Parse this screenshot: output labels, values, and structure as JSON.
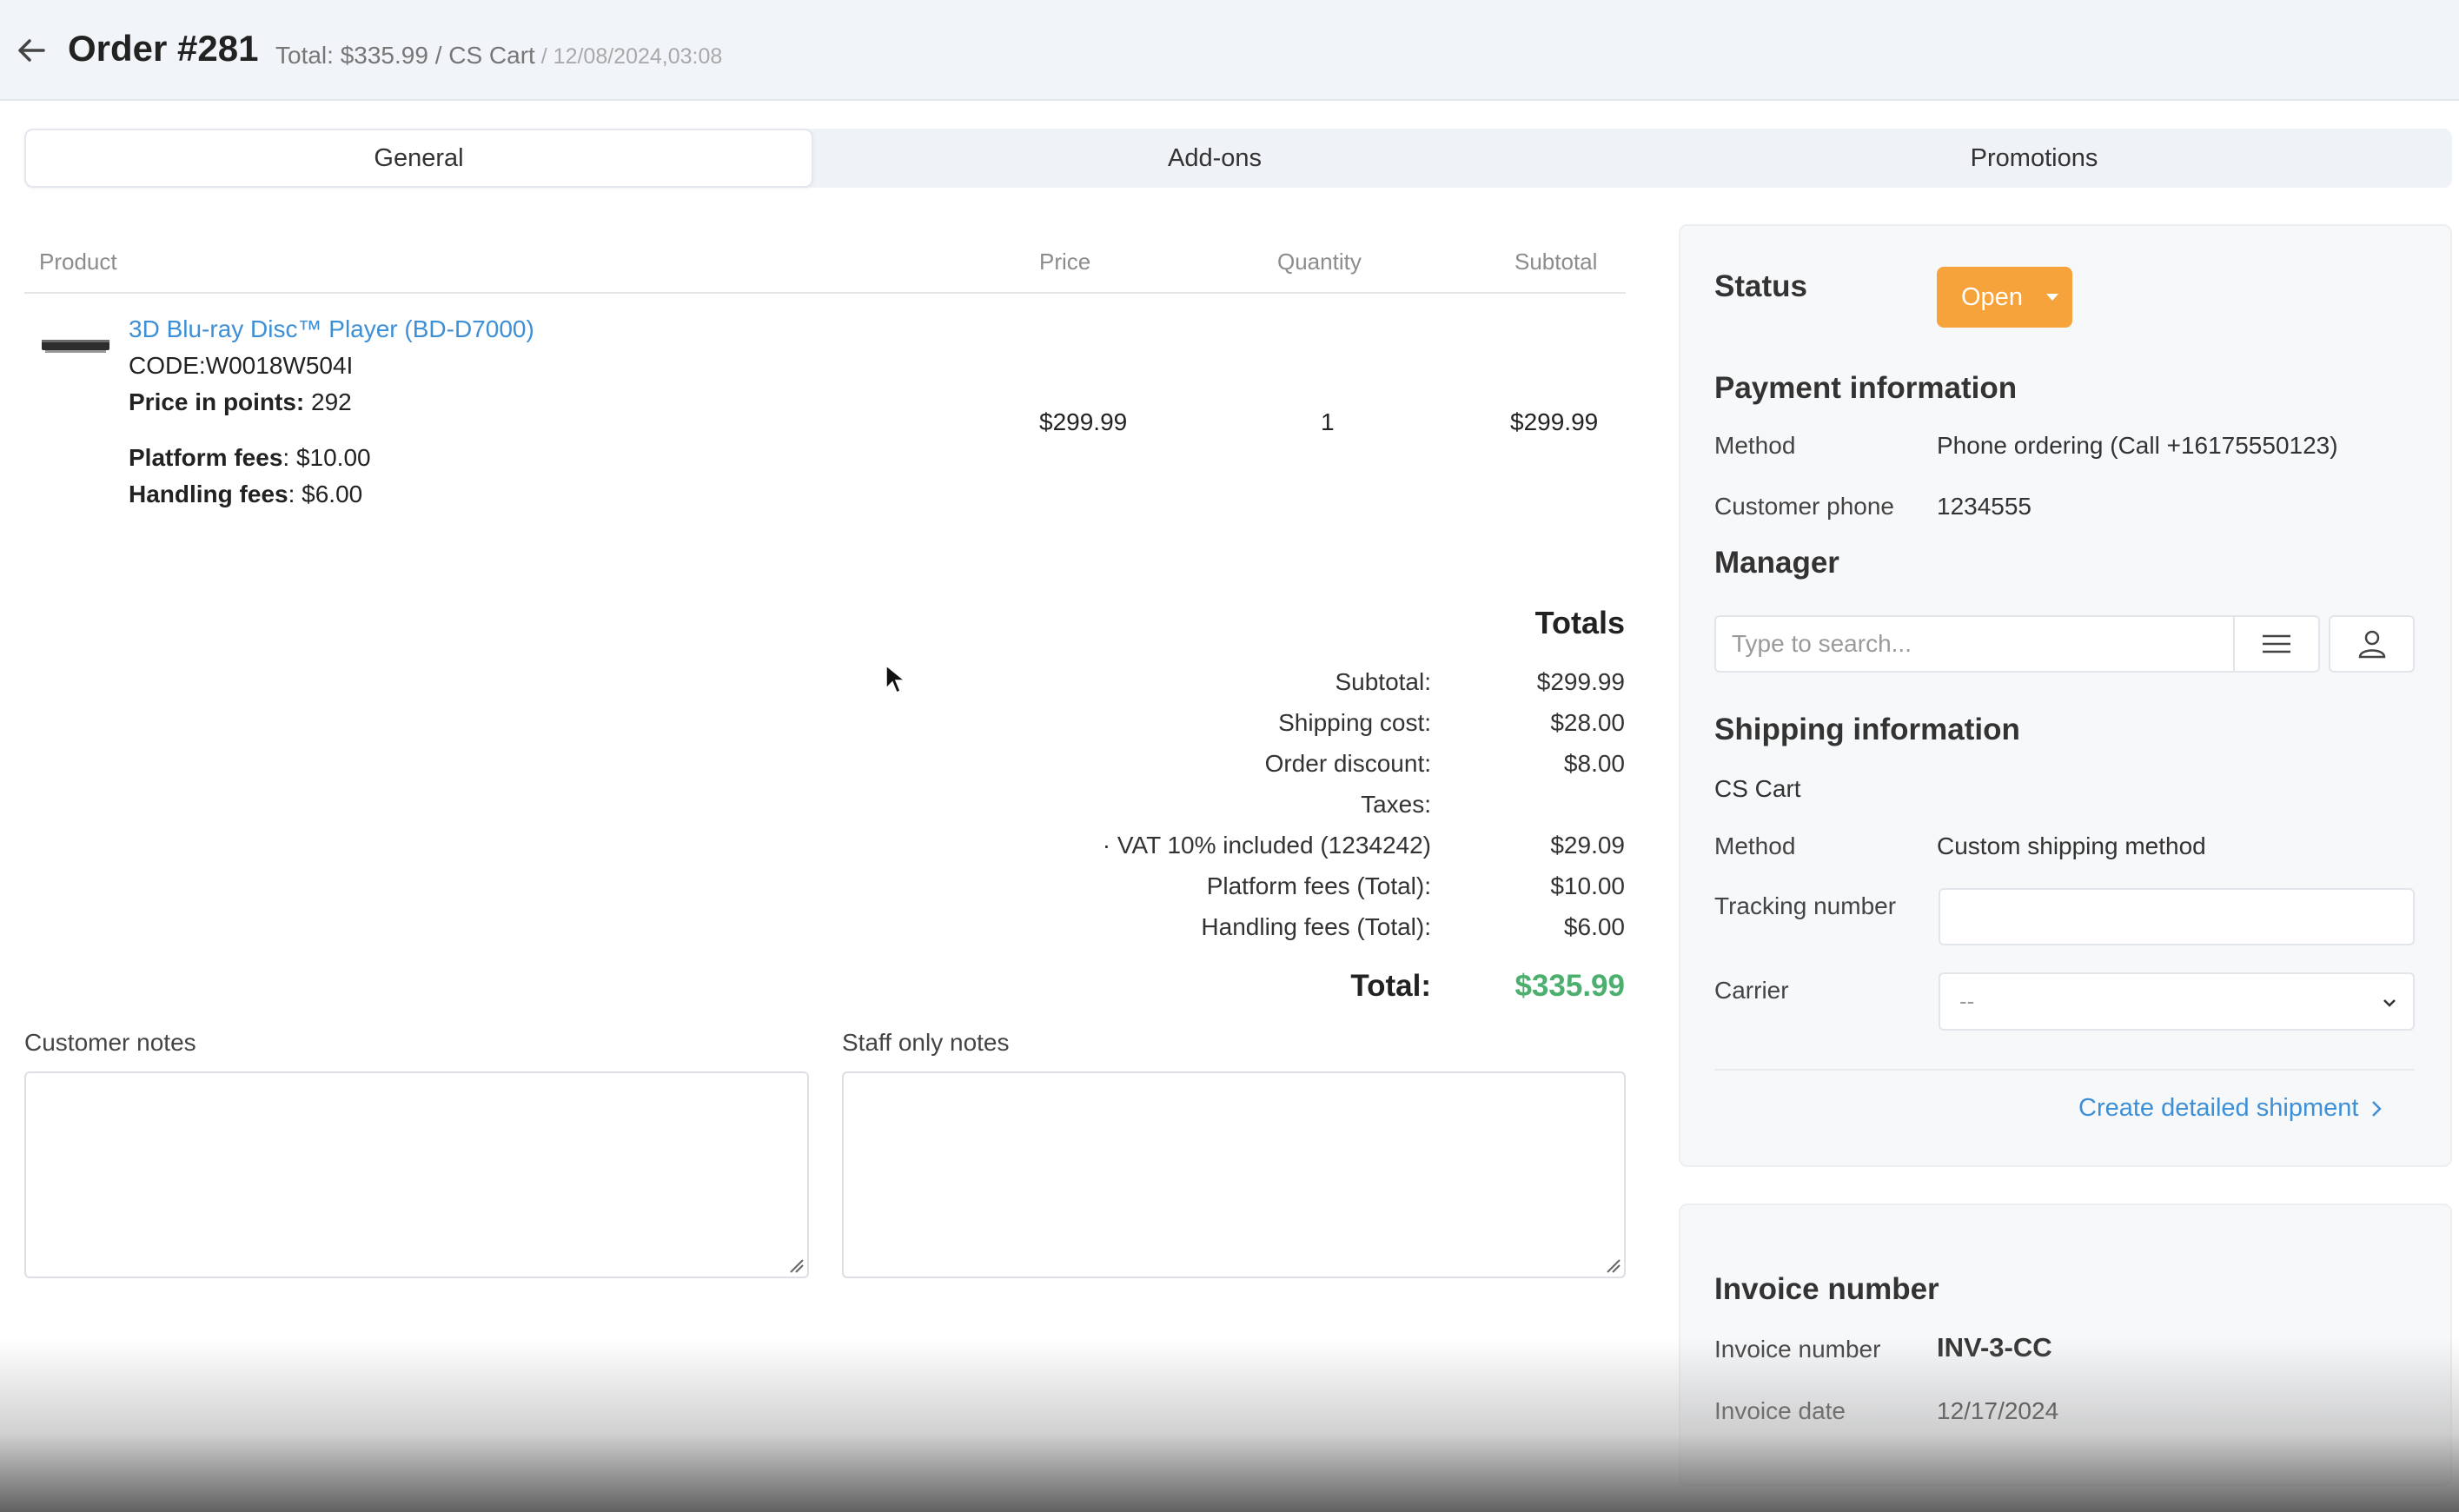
{
  "header": {
    "title": "Order #281",
    "meta": "Total: $335.99 / CS Cart",
    "date": " / 12/08/2024,03:08"
  },
  "tabs": [
    {
      "label": "General",
      "active": true
    },
    {
      "label": "Add-ons",
      "active": false
    },
    {
      "label": "Promotions",
      "active": false
    }
  ],
  "products_table": {
    "headers": {
      "product": "Product",
      "price": "Price",
      "quantity": "Quantity",
      "subtotal": "Subtotal"
    },
    "rows": [
      {
        "name": "3D Blu-ray Disc™ Player (BD-D7000)",
        "code": "CODE:W0018W504I",
        "points_label": "Price in points:",
        "points_value": " 292",
        "platform_fees_label": "Platform fees",
        "platform_fees_value": ": $10.00",
        "handling_fees_label": "Handling fees",
        "handling_fees_value": ": $6.00",
        "price": "$299.99",
        "quantity": "1",
        "subtotal": "$299.99",
        "thumbnail_icon": "blu-ray-player-icon"
      }
    ]
  },
  "totals": {
    "heading": "Totals",
    "lines": [
      {
        "label": "Subtotal:",
        "value": "$299.99"
      },
      {
        "label": "Shipping cost:",
        "value": "$28.00"
      },
      {
        "label": "Order discount:",
        "value": "$8.00"
      },
      {
        "label": "Taxes:",
        "value": ""
      },
      {
        "label": "· VAT 10% included (1234242)",
        "value": "$29.09"
      },
      {
        "label": "Platform fees (Total):",
        "value": "$10.00"
      },
      {
        "label": "Handling fees (Total):",
        "value": "$6.00"
      }
    ],
    "total_label": "Total:",
    "total_value": "$335.99",
    "total_color": "#4caf6e"
  },
  "notes": {
    "customer_label": "Customer notes",
    "customer_value": "",
    "staff_label": "Staff only notes",
    "staff_value": ""
  },
  "sidebar": {
    "status": {
      "label": "Status",
      "value": "Open",
      "color": "#f5a33a"
    },
    "payment": {
      "heading": "Payment information",
      "method_label": "Method",
      "method_value": "Phone ordering (Call +16175550123)",
      "phone_label": "Customer phone",
      "phone_value": "1234555"
    },
    "manager": {
      "heading": "Manager",
      "search_placeholder": "Type to search...",
      "list_icon": "list-icon",
      "user_icon": "user-icon"
    },
    "shipping": {
      "heading": "Shipping information",
      "store": "CS Cart",
      "method_label": "Method",
      "method_value": "Custom shipping method",
      "tracking_label": "Tracking number",
      "tracking_value": "",
      "carrier_label": "Carrier",
      "carrier_value": "--",
      "create_shipment_link": "Create detailed shipment"
    },
    "invoice": {
      "heading": "Invoice number",
      "number_label": "Invoice number",
      "number_value": "INV-3-CC",
      "date_label": "Invoice date",
      "date_value": "12/17/2024"
    }
  },
  "colors": {
    "accent": "#3d8fd6",
    "status_open": "#f5a33a",
    "total_green": "#4caf6e"
  }
}
